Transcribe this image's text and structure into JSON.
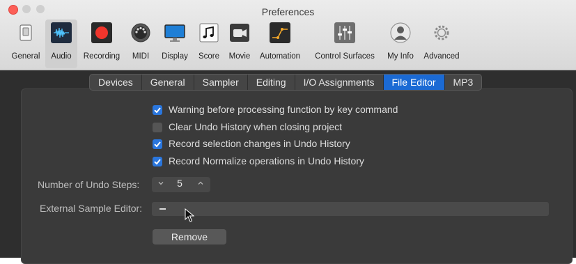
{
  "window": {
    "title": "Preferences"
  },
  "toolbar": {
    "items": [
      {
        "label": "General",
        "icon": "switch-icon"
      },
      {
        "label": "Audio",
        "icon": "waveform-icon",
        "active": true
      },
      {
        "label": "Recording",
        "icon": "record-icon"
      },
      {
        "label": "MIDI",
        "icon": "midi-port-icon"
      },
      {
        "label": "Display",
        "icon": "monitor-icon"
      },
      {
        "label": "Score",
        "icon": "music-note-icon"
      },
      {
        "label": "Movie",
        "icon": "video-camera-icon"
      },
      {
        "label": "Automation",
        "icon": "automation-curve-icon"
      },
      {
        "label": "Control Surfaces",
        "icon": "faders-icon"
      },
      {
        "label": "My Info",
        "icon": "person-icon"
      },
      {
        "label": "Advanced",
        "icon": "gears-icon"
      }
    ]
  },
  "tabs": [
    "Devices",
    "General",
    "Sampler",
    "Editing",
    "I/O Assignments",
    "File Editor",
    "MP3"
  ],
  "selected_tab": "File Editor",
  "checkboxes": [
    {
      "label": "Warning before processing function by key command",
      "checked": true
    },
    {
      "label": "Clear Undo History when closing project",
      "checked": false
    },
    {
      "label": "Record selection changes in Undo History",
      "checked": true
    },
    {
      "label": "Record Normalize operations in Undo History",
      "checked": true
    }
  ],
  "undo_steps": {
    "label": "Number of Undo Steps:",
    "value": "5"
  },
  "sample_editor": {
    "label": "External Sample Editor:",
    "value": "–"
  },
  "remove_button": {
    "label": "Remove"
  },
  "colors": {
    "accent": "#1b6ad4",
    "checkbox_on": "#2a76dd",
    "close": "#fc5f57"
  }
}
